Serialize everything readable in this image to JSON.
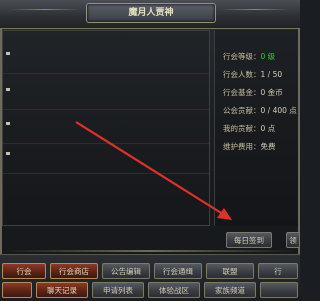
{
  "window": {
    "title": "魔月人贾神"
  },
  "guild_info": {
    "level_label": "行会等级：",
    "level_value": "0 级",
    "members_label": "行会人数：",
    "members_value": "1 / 50",
    "fund_label": "行会基金：",
    "fund_value": "0 金币",
    "contribution_label": "公会贡献：",
    "contribution_value": "0 / 400 点",
    "my_contribution_label": "我的贡献：",
    "my_contribution_value": "0 点",
    "upkeep_label": "维护费用：",
    "upkeep_value": "免费"
  },
  "actions": {
    "daily_sign_in": "每日签到",
    "partial_button": "领"
  },
  "bottom_tabs": {
    "row1": [
      "行会",
      "行会商店",
      "公告编辑",
      "行会通缉",
      "联盟",
      "行"
    ],
    "row2": [
      "",
      "聊天记录",
      "申请列表",
      "体验战区",
      "家族频道",
      ""
    ]
  },
  "colors": {
    "level_value": "#2fd12f",
    "button_red": "#6e2a1a",
    "annotation_arrow": "#e0302a"
  }
}
